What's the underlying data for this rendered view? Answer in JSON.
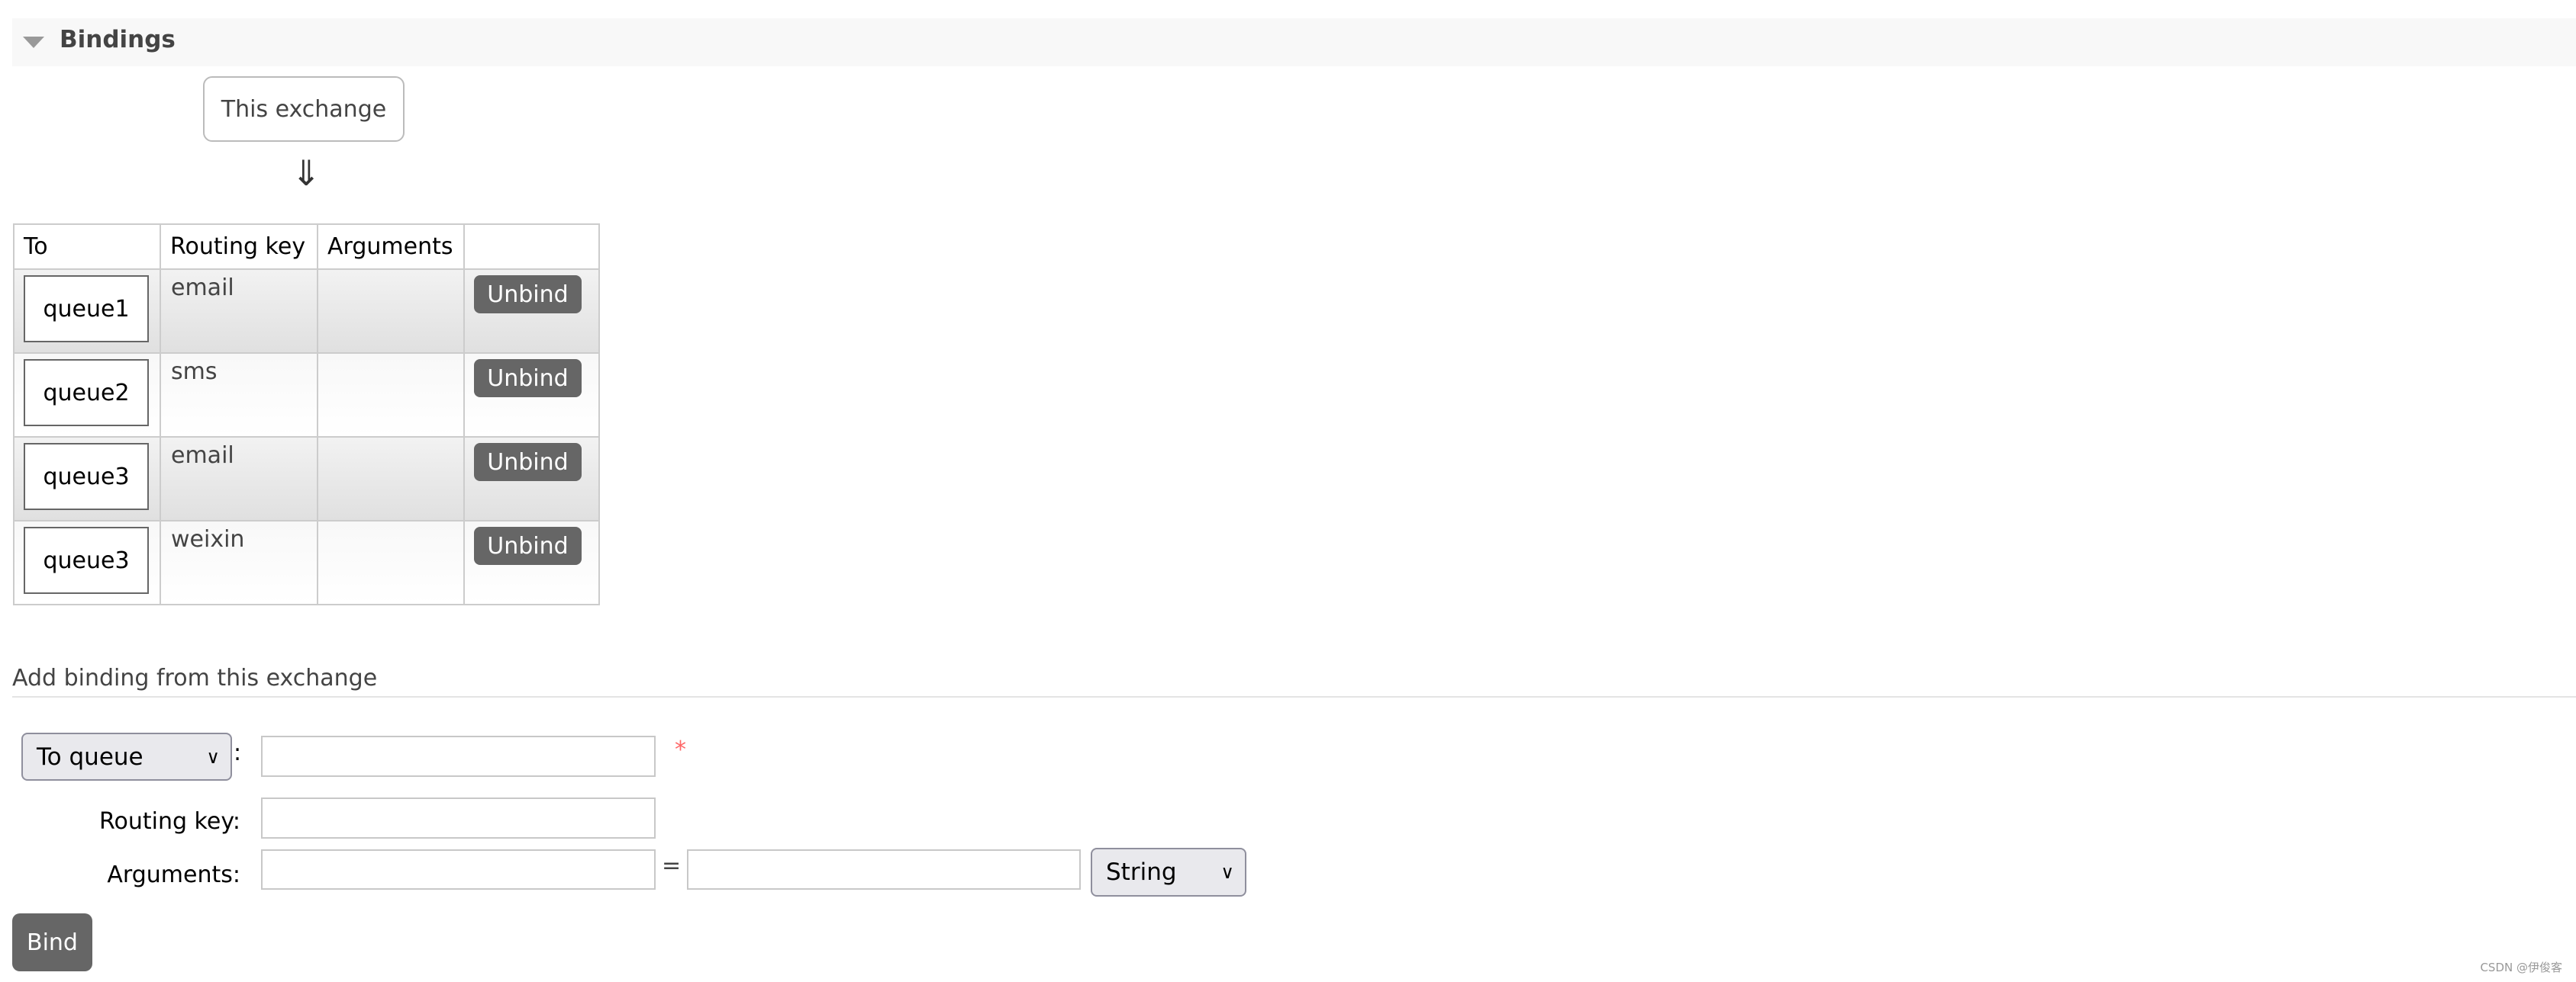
{
  "section": {
    "title": "Bindings",
    "icon": "triangle-down-icon"
  },
  "source": {
    "label": "This exchange",
    "arrow": "⇓"
  },
  "table": {
    "headers": [
      "To",
      "Routing key",
      "Arguments",
      ""
    ],
    "rows": [
      {
        "to": "queue1",
        "routing_key": "email",
        "arguments": "",
        "action": "Unbind"
      },
      {
        "to": "queue2",
        "routing_key": "sms",
        "arguments": "",
        "action": "Unbind"
      },
      {
        "to": "queue3",
        "routing_key": "email",
        "arguments": "",
        "action": "Unbind"
      },
      {
        "to": "queue3",
        "routing_key": "weixin",
        "arguments": "",
        "action": "Unbind"
      }
    ]
  },
  "add_binding": {
    "title": "Add binding from this exchange",
    "destination_type": "To queue",
    "colon": ":",
    "required_mark": "*",
    "destination_value": "",
    "routing_key_label": "Routing key:",
    "routing_key_value": "",
    "arguments_label": "Arguments:",
    "argument_key": "",
    "equals": "=",
    "argument_value": "",
    "argument_type": "String",
    "bind_label": "Bind"
  },
  "watermark": "CSDN @伊俊客",
  "colors": {
    "button": "#666666",
    "required": "#ff6666",
    "header_bg": "#f8f8f8"
  }
}
